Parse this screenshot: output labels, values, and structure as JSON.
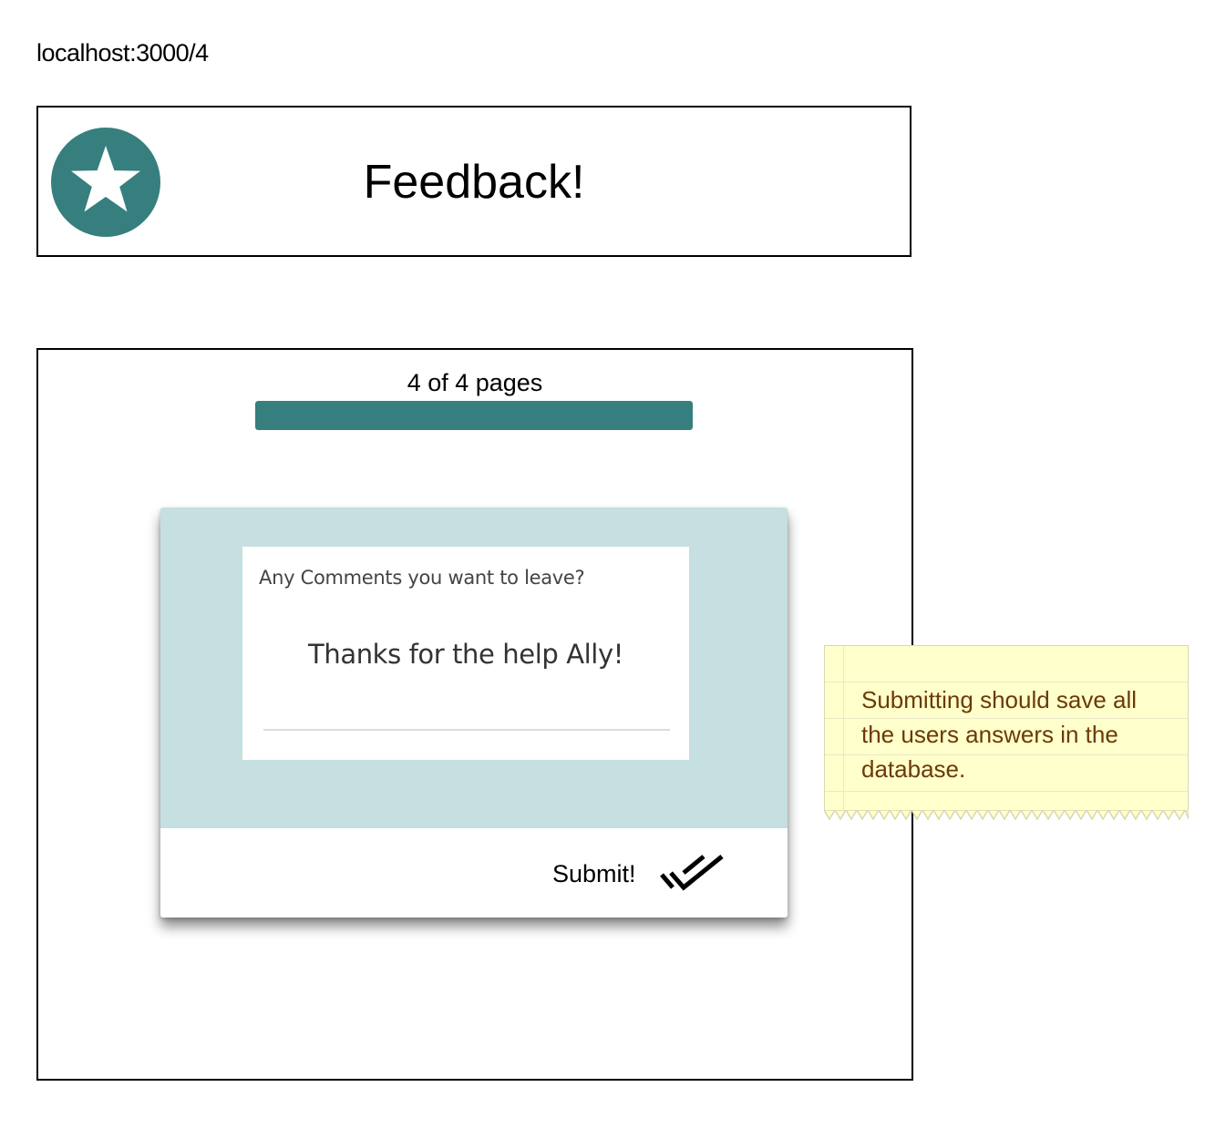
{
  "browser": {
    "url": "localhost:3000/4"
  },
  "header": {
    "title": "Feedback!",
    "logo_icon": "star-icon",
    "logo_color": "#367f7e"
  },
  "progress": {
    "label": "4 of 4 pages",
    "current_page": 4,
    "total_pages": 4,
    "fill_percent": 100,
    "color": "#367f7e"
  },
  "question_card": {
    "background_color": "#c6dfe1",
    "comment_field": {
      "label": "Any Comments you want to leave?",
      "value": "Thanks for the help Ally!"
    },
    "submit_button": {
      "label": "Submit!",
      "icon": "double-check-icon"
    }
  },
  "sticky_note": {
    "text": "Submitting should save all the users answers in the database.",
    "background_color": "#ffffcc",
    "text_color": "#6b3a06"
  }
}
